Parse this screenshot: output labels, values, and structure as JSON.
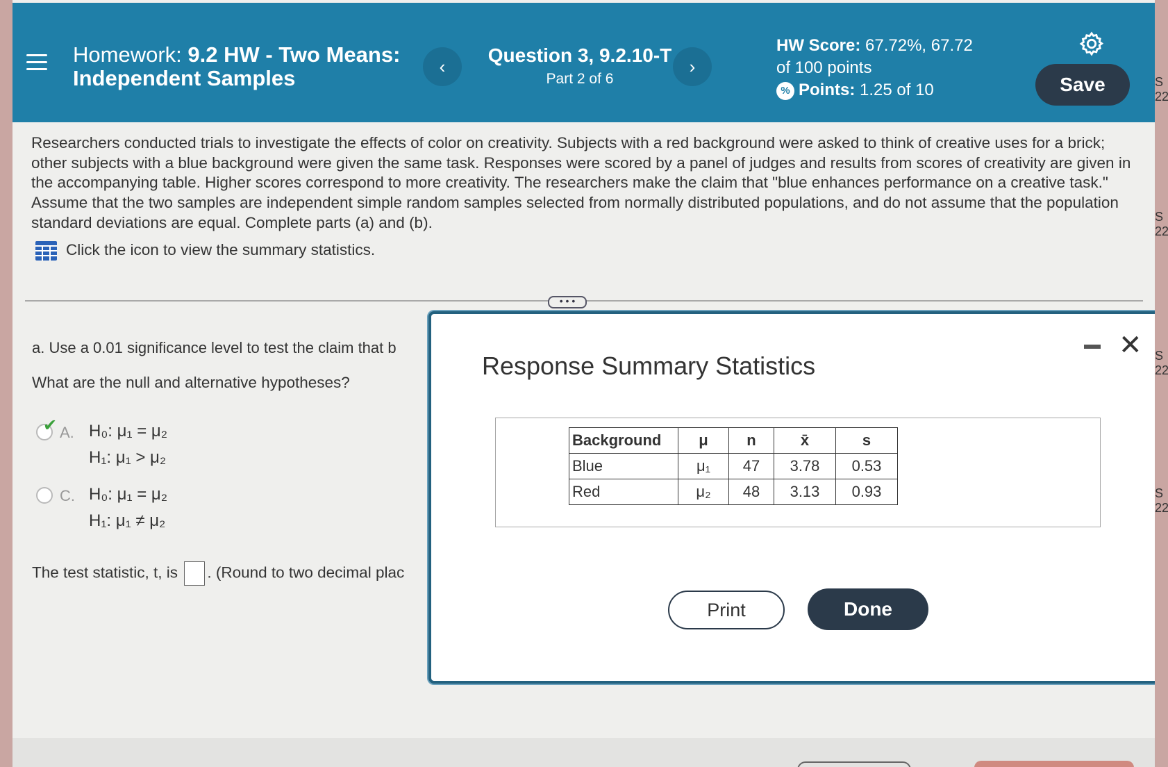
{
  "header": {
    "homework_label": "Homework:",
    "homework_title": "9.2 HW - Two Means: Independent Samples",
    "question_title": "Question 3, 9.2.10-T",
    "part": "Part 2 of 6",
    "hw_score_label": "HW Score:",
    "hw_score_value": "67.72%, 67.72",
    "hw_score_total": "of 100 points",
    "points_label": "Points:",
    "points_value": "1.25 of 10",
    "save_label": "Save",
    "prev_icon": "chevron-left-icon",
    "next_icon": "chevron-right-icon"
  },
  "problem": {
    "text": "Researchers conducted trials to investigate the effects of color on creativity. Subjects with a red background were asked to think of creative uses for a brick; other subjects with a blue background were given the same task. Responses were scored by a panel of judges and results from scores of creativity are given in the accompanying table. Higher scores correspond to more creativity. The researchers make the claim that \"blue enhances performance on a creative task.\" Assume that the two samples are independent simple random samples selected from normally distributed populations, and do not assume that the population standard deviations are equal. Complete parts (a) and (b).",
    "summary_link": "Click the icon to view the summary statistics."
  },
  "part_a": {
    "prompt": "a. Use a 0.01 significance level to test the claim that b",
    "hyp_question": "What are the null and alternative hypotheses?",
    "options": [
      {
        "letter": "A.",
        "h0": "H₀: μ₁ = μ₂",
        "h1": "H₁: μ₁ > μ₂",
        "selected": true
      },
      {
        "letter": "C.",
        "h0": "H₀: μ₁ = μ₂",
        "h1": "H₁: μ₁ ≠ μ₂",
        "selected": false
      }
    ],
    "test_stat_prefix": "The test statistic, t, is",
    "test_stat_suffix": ". (Round to two decimal plac"
  },
  "dialog": {
    "title": "Response Summary Statistics",
    "table": {
      "headers": [
        "Background",
        "μ",
        "n",
        "x̄",
        "s"
      ],
      "rows": [
        [
          "Blue",
          "μ₁",
          "47",
          "3.78",
          "0.53"
        ],
        [
          "Red",
          "μ₂",
          "48",
          "3.13",
          "0.93"
        ]
      ]
    },
    "print_label": "Print",
    "done_label": "Done"
  },
  "edge": {
    "label": "S",
    "values": [
      "22",
      "22",
      "22",
      "22"
    ]
  }
}
